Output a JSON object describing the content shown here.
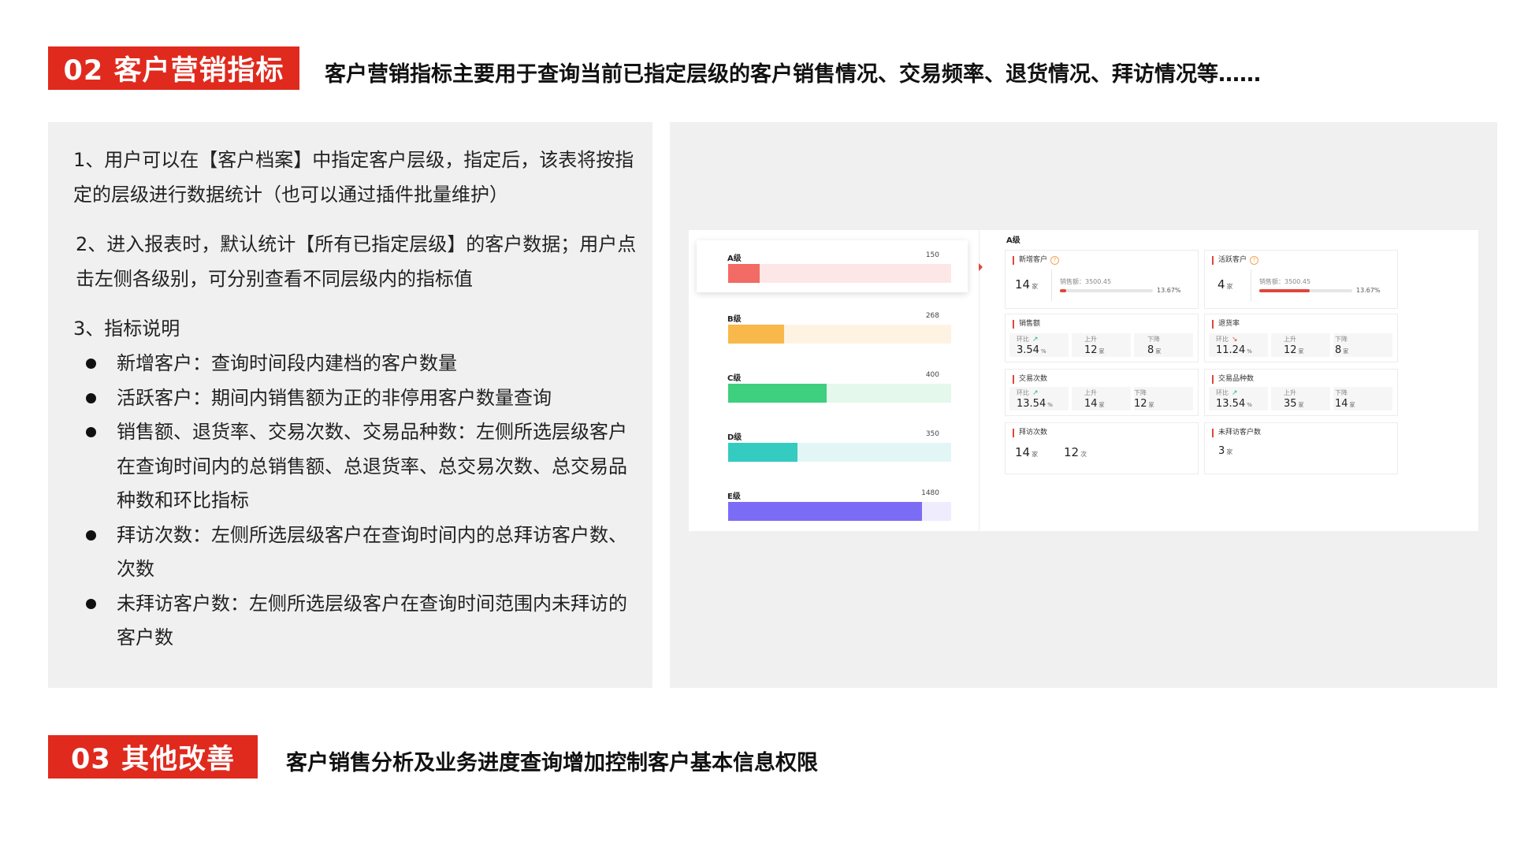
{
  "section02": {
    "tag": "02 客户营销指标",
    "headline": "客户营销指标主要用于查询当前已指定层级的客户销售情况、交易频率、退货情况、拜访情况等……"
  },
  "left_panel": {
    "p1": "1、用户可以在【客户档案】中指定客户层级，指定后，该表将按指定的层级进行数据统计（也可以通过插件批量维护）",
    "p2": "2、进入报表时，默认统计【所有已指定层级】的客户数据；用户点击左侧各级别，可分别查看不同层级内的指标值",
    "p3": "3、指标说明",
    "bullets": [
      "新增客户：查询时间段内建档的客户数量",
      "活跃客户：期间内销售额为正的非停用客户数量查询",
      "销售额、退货率、交易次数、交易品种数：左侧所选层级客户在查询时间内的总销售额、总退货率、总交易次数、总交易品种数和环比指标",
      "拜访次数：左侧所选层级客户在查询时间内的总拜访客户数、次数",
      "未拜访客户数：左侧所选层级客户在查询时间范围内未拜访的客户数"
    ]
  },
  "dashboard": {
    "title": "A级",
    "levels": [
      {
        "name": "A级",
        "value": 150,
        "fill": 0.14,
        "color": "#f26b64",
        "track": "#fde7e6",
        "selected": true
      },
      {
        "name": "B级",
        "value": 268,
        "fill": 0.25,
        "color": "#f9b84a",
        "track": "#fef3e2",
        "selected": false
      },
      {
        "name": "C级",
        "value": 400,
        "fill": 0.44,
        "color": "#3ecf7f",
        "track": "#e4f8ec",
        "selected": false
      },
      {
        "name": "D级",
        "value": 350,
        "fill": 0.31,
        "color": "#34cbc1",
        "track": "#e2f7f5",
        "selected": false
      },
      {
        "name": "E级",
        "value": 1480,
        "fill": 0.87,
        "color": "#7c6cf5",
        "track": "#eeecfd",
        "selected": false
      }
    ],
    "cards": {
      "new_customers": {
        "label": "新增客户",
        "value": "14",
        "unit": "家",
        "sales_label": "销售额：",
        "sales": "3500.45",
        "pct": "13.67%",
        "ratio": 0.07
      },
      "active_customers": {
        "label": "活跃客户",
        "value": "4",
        "unit": "家",
        "sales_label": "销售额：",
        "sales": "3500.45",
        "pct": "13.67%",
        "ratio": 0.54
      },
      "sales": {
        "label": "销售额",
        "mom_label": "环比",
        "mom": "3.54",
        "mom_unit": "%",
        "up_label": "上升",
        "up": "12",
        "up_unit": "家",
        "down_label": "下降",
        "down": "8",
        "down_unit": "家"
      },
      "return_rate": {
        "label": "退货率",
        "mom_label": "环比",
        "mom": "11.24",
        "mom_unit": "%",
        "up_label": "上升",
        "up": "12",
        "up_unit": "家",
        "down_label": "下降",
        "down": "8",
        "down_unit": "家"
      },
      "trade_count": {
        "label": "交易次数",
        "mom_label": "环比",
        "mom": "13.54",
        "mom_unit": "%",
        "up_label": "上升",
        "up": "14",
        "up_unit": "家",
        "down_label": "下降",
        "down": "12",
        "down_unit": "家"
      },
      "trade_varieties": {
        "label": "交易品种数",
        "mom_label": "环比",
        "mom": "13.54",
        "mom_unit": "%",
        "up_label": "上升",
        "up": "35",
        "up_unit": "家",
        "down_label": "下降",
        "down": "14",
        "down_unit": "家"
      },
      "visits": {
        "label": "拜访次数",
        "customers": "14",
        "customers_unit": "家",
        "times": "12",
        "times_unit": "次"
      },
      "unvisited": {
        "label": "未拜访客户数",
        "value": "3",
        "unit": "家"
      }
    }
  },
  "section03": {
    "tag": "03 其他改善",
    "headline": "客户销售分析及业务进度查询增加控制客户基本信息权限"
  }
}
